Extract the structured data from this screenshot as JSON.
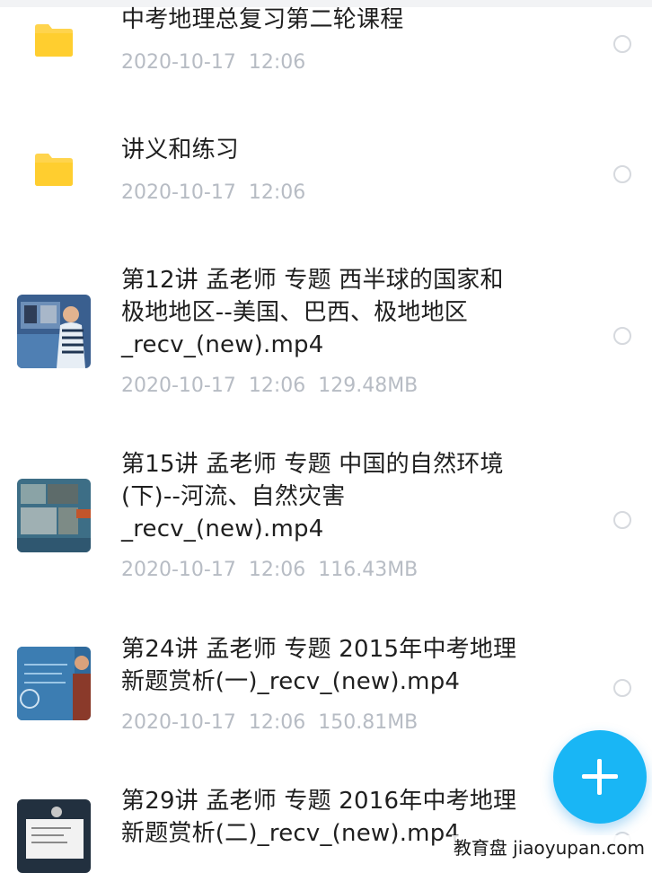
{
  "files": [
    {
      "name": "中考地理总复习第二轮课程",
      "meta": "2020-10-17  12:06",
      "type": "folder"
    },
    {
      "name": "讲义和练习",
      "meta": "2020-10-17  12:06",
      "type": "folder"
    },
    {
      "name": "第12讲 孟老师 专题 西半球的国家和\n极地地区--美国、巴西、极地地区\n_recv_(new).mp4",
      "meta": "2020-10-17  12:06  129.48MB",
      "type": "video"
    },
    {
      "name": "第15讲 孟老师 专题 中国的自然环境\n(下)--河流、自然灾害\n_recv_(new).mp4",
      "meta": "2020-10-17  12:06  116.43MB",
      "type": "video"
    },
    {
      "name": "第24讲 孟老师 专题 2015年中考地理\n新题赏析(一)_recv_(new).mp4",
      "meta": "2020-10-17  12:06  150.81MB",
      "type": "video"
    },
    {
      "name": "第29讲 孟老师 专题 2016年中考地理\n新题赏析(二)_recv_(new).mp4",
      "meta": "",
      "type": "video"
    }
  ],
  "fab_icon": "plus-icon",
  "watermark": "教育盘 jiaoyupan.com",
  "colors": {
    "folder": "#ffd44d",
    "accent": "#19b6f5",
    "meta": "#b7bcc4"
  }
}
